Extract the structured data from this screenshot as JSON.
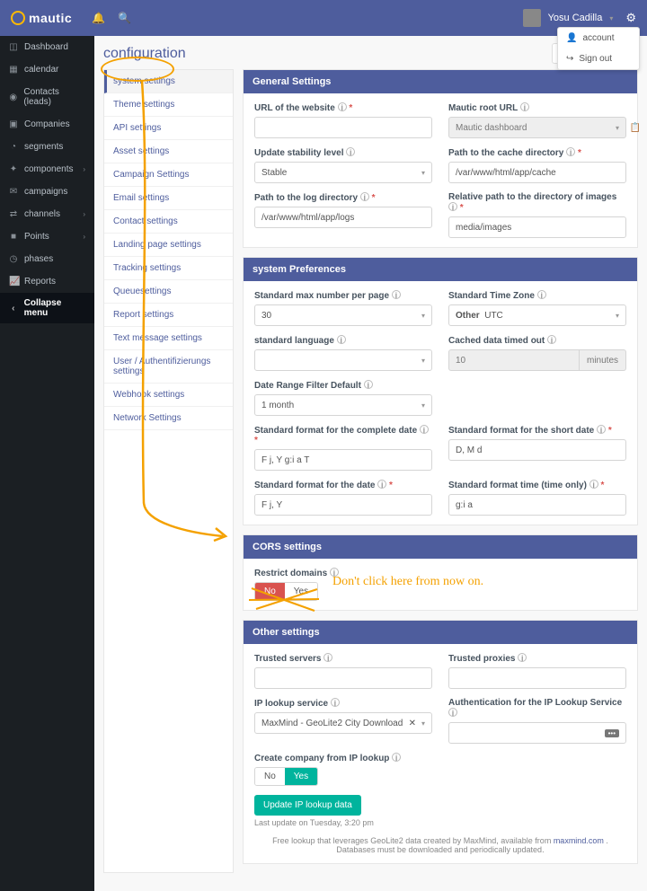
{
  "brand": "mautic",
  "user": {
    "name": "Yosu Cadilla"
  },
  "dropdown": {
    "account": "account",
    "signout": "Sign out"
  },
  "page_title": "configuration",
  "head_buttons": {
    "abort": "Abort",
    "apply": "ly"
  },
  "leftnav": [
    {
      "icon": "◫",
      "label": "Dashboard"
    },
    {
      "icon": "▦",
      "label": "calendar"
    },
    {
      "icon": "◉",
      "label": "Contacts (leads)"
    },
    {
      "icon": "▣",
      "label": "Companies"
    },
    {
      "icon": "◔",
      "label": "segments"
    },
    {
      "icon": "✦",
      "label": "components",
      "sub": true
    },
    {
      "icon": "✉",
      "label": "campaigns"
    },
    {
      "icon": "⇄",
      "label": "channels",
      "sub": true
    },
    {
      "icon": "■",
      "label": "Points",
      "sub": true
    },
    {
      "icon": "◷",
      "label": "phases"
    },
    {
      "icon": "📈",
      "label": "Reports"
    }
  ],
  "collapse": "Collapse menu",
  "setnav": [
    "system settings",
    "Theme settings",
    "API settings",
    "Asset settings",
    "Campaign Settings",
    "Email settings",
    "Contact settings",
    "Landing page settings",
    "Tracking settings",
    "Queuesettings",
    "Report settings",
    "Text message settings",
    "User / Authentifizierungs settings",
    "Webhook settings",
    "Network Settings"
  ],
  "general": {
    "title": "General Settings",
    "url_label": "URL of the website",
    "root_label": "Mautic root URL",
    "root_value": "Mautic dashboard",
    "stability_label": "Update stability level",
    "stability_value": "Stable",
    "cache_label": "Path to the cache directory",
    "cache_value": "/var/www/html/app/cache",
    "log_label": "Path to the log directory",
    "log_value": "/var/www/html/app/logs",
    "images_label": "Relative path to the directory of images",
    "images_value": "media/images"
  },
  "prefs": {
    "title": "system Preferences",
    "maxnum_label": "Standard max number per page",
    "maxnum_value": "30",
    "tz_label": "Standard Time Zone",
    "tz_value": "Other  UTC",
    "lang_label": "standard language",
    "cache_timeout_label": "Cached data timed out",
    "cache_timeout_value": "10",
    "cache_unit": "minutes",
    "daterange_label": "Date Range Filter Default",
    "daterange_value": "1 month",
    "fmt_full_label": "Standard format for the complete date",
    "fmt_full_value": "F j, Y g:i a T",
    "fmt_short_label": "Standard format for the short date",
    "fmt_short_value": "D, M d",
    "fmt_date_label": "Standard format for the date",
    "fmt_date_value": "F j, Y",
    "fmt_time_label": "Standard format time (time only)",
    "fmt_time_value": "g:i a"
  },
  "cors": {
    "title": "CORS settings",
    "restrict_label": "Restrict domains",
    "no": "No",
    "yes": "Yes"
  },
  "other": {
    "title": "Other settings",
    "trusted_servers": "Trusted servers",
    "trusted_proxies": "Trusted proxies",
    "ip_service_label": "IP lookup service",
    "ip_service_value": "MaxMind - GeoLite2 City Download",
    "auth_label": "Authentication for the IP Lookup Service",
    "create_company_label": "Create company from IP lookup",
    "no": "No",
    "yes": "Yes",
    "update_btn": "Update IP lookup data",
    "last_update": "Last update on Tuesday, 3:20 pm",
    "footnote_a": "Free lookup that leverages GeoLite2 data created by MaxMind, available from ",
    "footnote_link": "maxmind.com",
    "footnote_b": " . Databases must be downloaded and periodically updated."
  },
  "annotation": "Don't click here from now on."
}
